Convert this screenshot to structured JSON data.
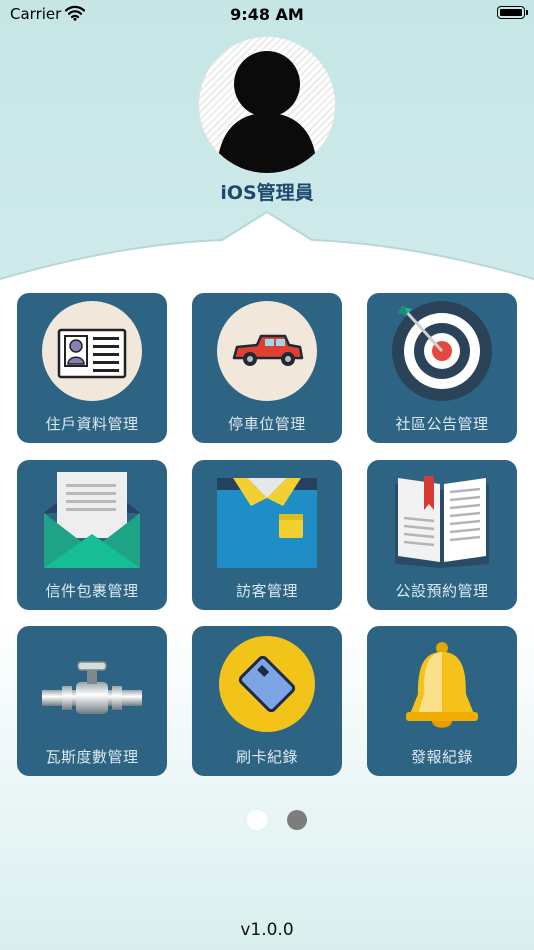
{
  "status_bar": {
    "carrier": "Carrier",
    "time": "9:48 AM"
  },
  "header": {
    "user_name": "iOS管理員"
  },
  "tiles": [
    {
      "label": "住戶資料管理",
      "icon": "id-card-icon"
    },
    {
      "label": "停車位管理",
      "icon": "car-icon"
    },
    {
      "label": "社區公告管理",
      "icon": "target-icon"
    },
    {
      "label": "信件包裹管理",
      "icon": "envelope-icon"
    },
    {
      "label": "訪客管理",
      "icon": "shirt-icon"
    },
    {
      "label": "公設預約管理",
      "icon": "book-icon"
    },
    {
      "label": "瓦斯度數管理",
      "icon": "pipe-valve-icon"
    },
    {
      "label": "刷卡紀錄",
      "icon": "card-icon"
    },
    {
      "label": "發報紀錄",
      "icon": "bell-icon"
    }
  ],
  "pager": {
    "pages": 2,
    "current": 1
  },
  "footer": {
    "version": "v1.0.0"
  },
  "colors": {
    "tile_bg": "#2e6483",
    "name_text": "#1f4a6e",
    "accent_bg": "#c6e6e6"
  }
}
